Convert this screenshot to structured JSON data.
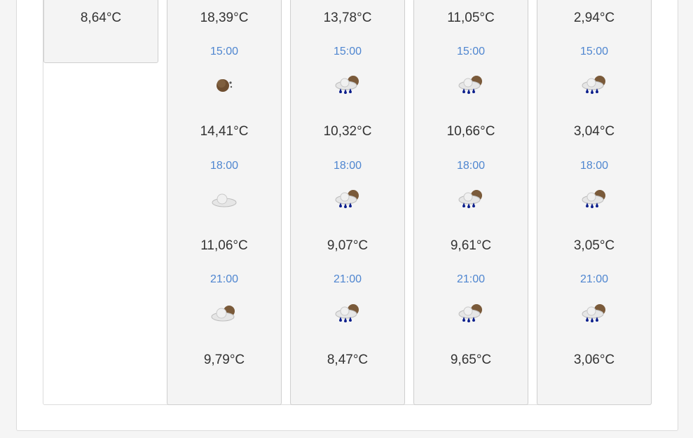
{
  "columns": [
    {
      "temps": [
        "8,64°C"
      ]
    },
    {
      "temps": [
        "18,39°C",
        "14,41°C",
        "11,06°C",
        "9,79°C"
      ],
      "times": [
        "15:00",
        "18:00",
        "21:00"
      ],
      "icons": [
        "moon-clear-icon",
        "cloud-icon",
        "cloud-moon-icon"
      ]
    },
    {
      "temps": [
        "13,78°C",
        "10,32°C",
        "9,07°C",
        "8,47°C"
      ],
      "times": [
        "15:00",
        "18:00",
        "21:00"
      ],
      "icons": [
        "rain-cloud-moon-icon",
        "rain-cloud-moon-icon",
        "rain-cloud-moon-icon"
      ]
    },
    {
      "temps": [
        "11,05°C",
        "10,66°C",
        "9,61°C",
        "9,65°C"
      ],
      "times": [
        "15:00",
        "18:00",
        "21:00"
      ],
      "icons": [
        "rain-cloud-moon-icon",
        "rain-cloud-moon-icon",
        "rain-cloud-moon-icon"
      ]
    },
    {
      "temps": [
        "2,94°C",
        "3,04°C",
        "3,05°C",
        "3,06°C"
      ],
      "times": [
        "15:00",
        "18:00",
        "21:00"
      ],
      "icons": [
        "rain-cloud-moon-icon",
        "rain-cloud-moon-icon",
        "rain-cloud-moon-icon"
      ]
    }
  ],
  "colors": {
    "time": "#4f86d0",
    "temp": "#333333",
    "rain": "#0b1e8c",
    "moon": "#7a5a3a"
  }
}
